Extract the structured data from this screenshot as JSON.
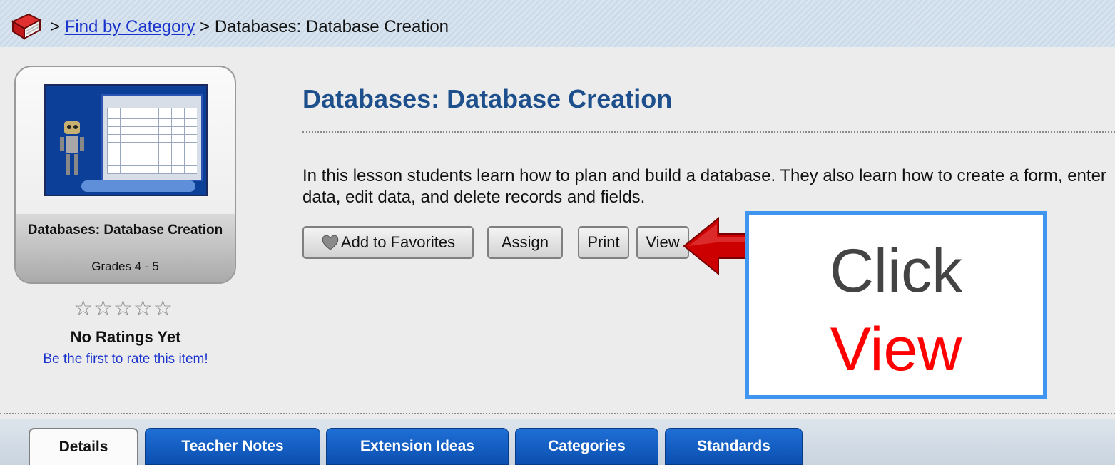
{
  "breadcrumb": {
    "icon": "book-icon",
    "sep1": ">",
    "link": "Find by Category",
    "sep2": ">",
    "current": "Databases: Database Creation"
  },
  "card": {
    "title": "Databases: Database Creation",
    "grades": "Grades 4 - 5"
  },
  "rating": {
    "stars": "☆☆☆☆☆",
    "value": 0,
    "max": 5,
    "label": "No Ratings Yet",
    "prompt": "Be the first to rate this item!"
  },
  "lesson": {
    "title": "Databases: Database Creation",
    "description": "In this lesson students learn how to plan and build a database. They also learn how to create a form, enter data, edit data, and delete records and fields."
  },
  "buttons": {
    "favorites": "Add to Favorites",
    "assign": "Assign",
    "print": "Print",
    "view": "View"
  },
  "callout": {
    "line1": "Click",
    "line2": "View"
  },
  "tabs": [
    {
      "label": "Details",
      "active": true
    },
    {
      "label": "Teacher Notes",
      "active": false
    },
    {
      "label": "Extension Ideas",
      "active": false
    },
    {
      "label": "Categories",
      "active": false
    },
    {
      "label": "Standards",
      "active": false
    }
  ],
  "colors": {
    "tab_blue": "#1f6fd6",
    "title_blue": "#1c4f8c",
    "arrow_red": "#cc0000",
    "callout_border": "#3f95f0"
  }
}
